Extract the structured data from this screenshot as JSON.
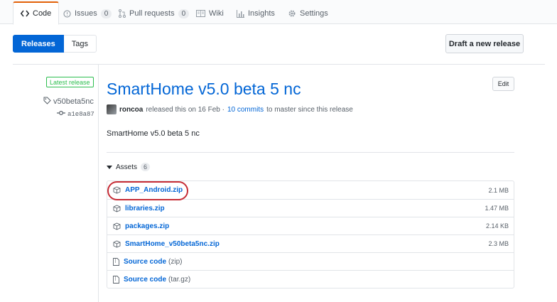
{
  "tabs": [
    {
      "label": "Code",
      "icon": "code-icon",
      "selected": true
    },
    {
      "label": "Issues",
      "icon": "issue-icon",
      "count": "0"
    },
    {
      "label": "Pull requests",
      "icon": "pull-request-icon",
      "count": "0"
    },
    {
      "label": "Wiki",
      "icon": "book-icon"
    },
    {
      "label": "Insights",
      "icon": "graph-icon"
    },
    {
      "label": "Settings",
      "icon": "gear-icon"
    }
  ],
  "toggle": {
    "releases": "Releases",
    "tags": "Tags"
  },
  "draft_button": "Draft a new release",
  "sidebar": {
    "latest_label": "Latest release",
    "tag": "v50beta5nc",
    "commit": "a1e8a87"
  },
  "release": {
    "title": "SmartHome v5.0 beta 5 nc",
    "edit_label": "Edit",
    "author": "roncoa",
    "released_text": "released this on 16 Feb ·",
    "commits_link": "10 commits",
    "commits_suffix": "to master since this release",
    "body": "SmartHome v5.0 beta 5 nc"
  },
  "assets": {
    "label": "Assets",
    "count": "6",
    "items": [
      {
        "name": "APP_Android.zip",
        "size": "2.1 MB",
        "icon": "package-icon"
      },
      {
        "name": "libraries.zip",
        "size": "1.47 MB",
        "icon": "package-icon"
      },
      {
        "name": "packages.zip",
        "size": "2.14 KB",
        "icon": "package-icon"
      },
      {
        "name": "SmartHome_v50beta5nc.zip",
        "size": "2.3 MB",
        "icon": "package-icon"
      },
      {
        "name": "Source code",
        "paren": "(zip)",
        "size": "",
        "icon": "file-zip-icon"
      },
      {
        "name": "Source code",
        "paren": "(tar.gz)",
        "size": "",
        "icon": "file-zip-icon"
      }
    ]
  },
  "colors": {
    "accent": "#0366d6",
    "highlight": "#c62d36",
    "latest": "#2cbe4e",
    "tab_active": "#e36209"
  }
}
